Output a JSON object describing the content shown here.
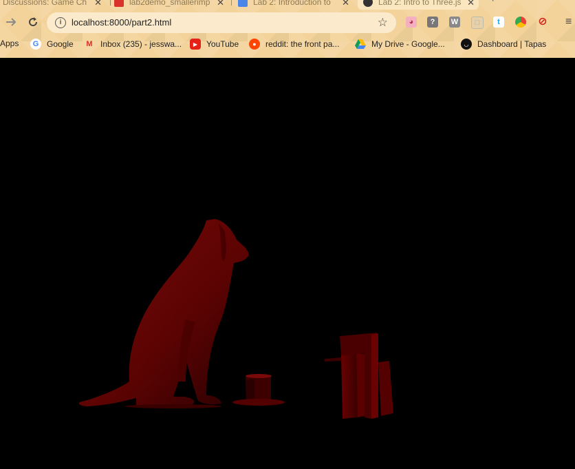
{
  "tabs": [
    {
      "title": "Discussions: Game Ch",
      "active": false
    },
    {
      "title": "lab2demo_smallerimp",
      "active": false
    },
    {
      "title": "Lab 2: Introduction to",
      "active": false
    },
    {
      "title": "Lab 2: Intro to Three.js",
      "active": true
    }
  ],
  "toolbar": {
    "url": "localhost:8000/part2.html"
  },
  "bookmarks": [
    {
      "label": "Apps",
      "icon": "apps-icon"
    },
    {
      "label": "Google",
      "icon": "google-icon"
    },
    {
      "label": "Inbox (235) - jesswa...",
      "icon": "gmail-icon"
    },
    {
      "label": "YouTube",
      "icon": "youtube-icon"
    },
    {
      "label": "reddit: the front pa...",
      "icon": "reddit-icon"
    },
    {
      "label": "My Drive - Google...",
      "icon": "drive-icon"
    },
    {
      "label": "Dashboard | Tapas",
      "icon": "tapas-icon"
    }
  ],
  "scene": {
    "background": "#000000",
    "object_color": "#6b0000",
    "objects": [
      "dog",
      "cup",
      "books"
    ]
  }
}
